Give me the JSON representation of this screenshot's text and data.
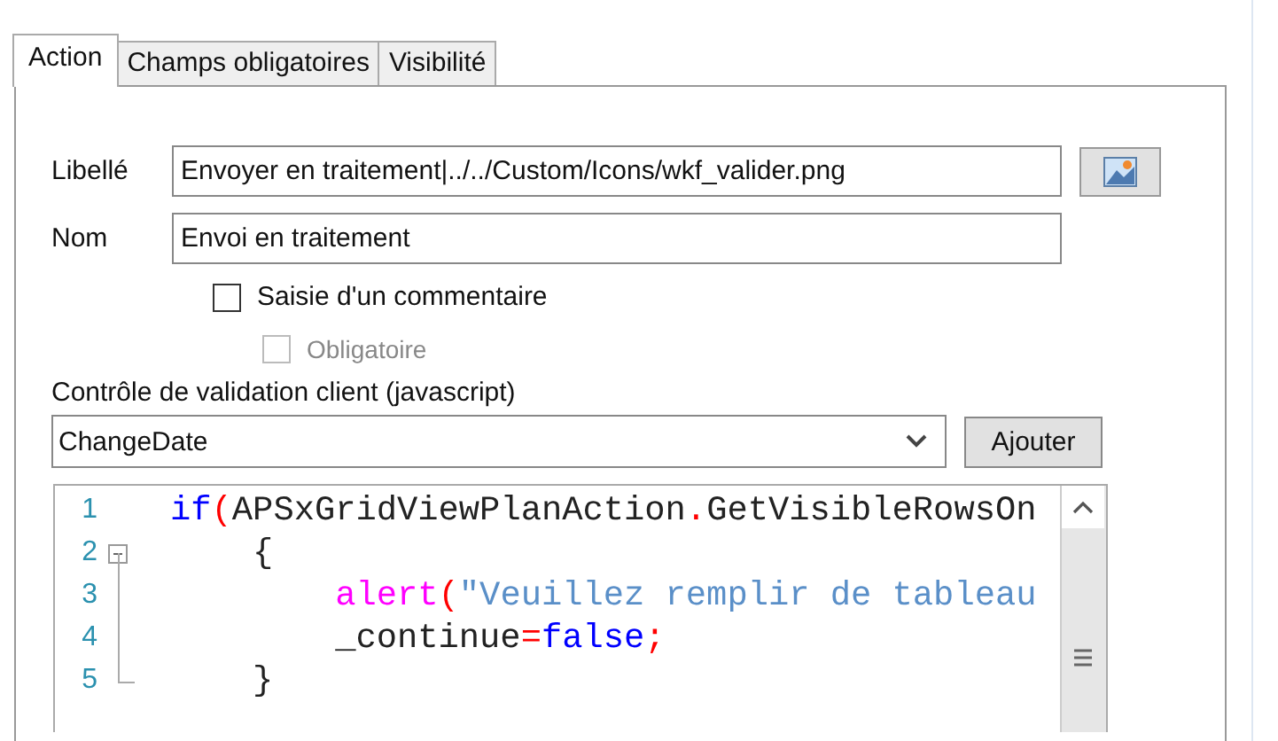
{
  "tabs": [
    {
      "label": "Action",
      "selected": true
    },
    {
      "label": "Champs obligatoires",
      "selected": false
    },
    {
      "label": "Visibilité",
      "selected": false
    }
  ],
  "form": {
    "libelle": {
      "label": "Libellé",
      "value": "Envoyer en traitement|../../Custom/Icons/wkf_valider.png"
    },
    "nom": {
      "label": "Nom",
      "value": "Envoi en traitement"
    },
    "checkboxes": [
      {
        "label": "Saisie d'un commentaire",
        "checked": false,
        "disabled": false
      },
      {
        "label": "Obligatoire",
        "checked": false,
        "disabled": true
      }
    ],
    "validation_label": "Contrôle de validation client (javascript)",
    "validation_select": "ChangeDate",
    "add_button": "Ajouter"
  },
  "code_lines": [
    {
      "number": "1",
      "foldable": false,
      "tokens": [
        {
          "kind": "keyword",
          "text": "if"
        },
        {
          "kind": "op",
          "text": "("
        },
        {
          "kind": "plain",
          "text": "APSxGridViewPlanAction"
        },
        {
          "kind": "op",
          "text": "."
        },
        {
          "kind": "plain",
          "text": "GetVisibleRowsOn"
        }
      ]
    },
    {
      "number": "2",
      "foldable": true,
      "tokens": [
        {
          "kind": "plain",
          "text": "    {"
        }
      ]
    },
    {
      "number": "3",
      "foldable": false,
      "tokens": [
        {
          "kind": "func",
          "text": "        alert"
        },
        {
          "kind": "op",
          "text": "("
        },
        {
          "kind": "string",
          "text": "\"Veuillez remplir de tableau"
        }
      ]
    },
    {
      "number": "4",
      "foldable": false,
      "tokens": [
        {
          "kind": "plain",
          "text": "        _continue"
        },
        {
          "kind": "op",
          "text": "="
        },
        {
          "kind": "keyword",
          "text": "false"
        },
        {
          "kind": "op",
          "text": ";"
        }
      ]
    },
    {
      "number": "5",
      "foldable": false,
      "tokens": [
        {
          "kind": "plain",
          "text": "    }"
        }
      ]
    }
  ]
}
